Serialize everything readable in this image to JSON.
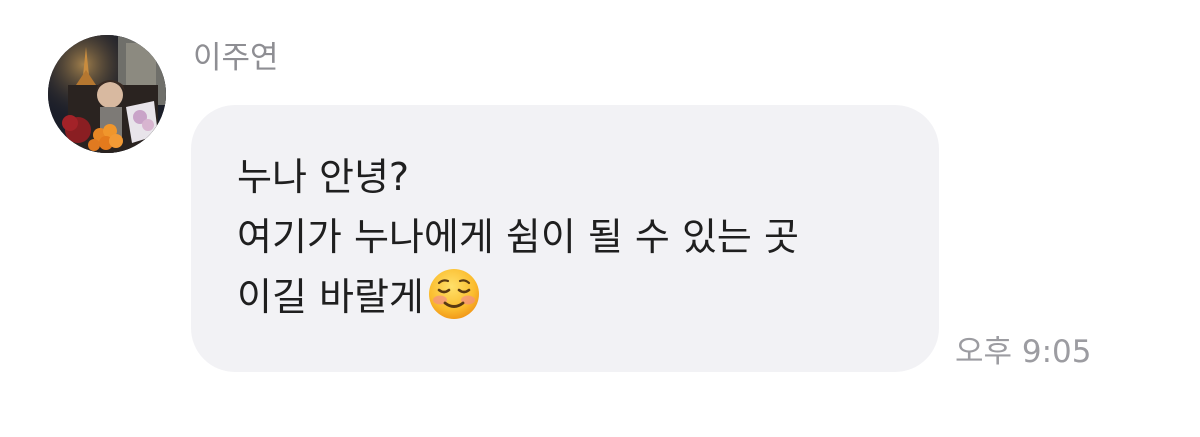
{
  "message": {
    "sender_name": "이주연",
    "avatar_icon": "profile-photo",
    "lines": [
      "누나 안녕?",
      "여기가 누나에게 쉼이 될 수 있는 곳",
      "이길 바랄게"
    ],
    "emoji": "smiling-face-icon",
    "timestamp": "오후 9:05"
  },
  "colors": {
    "bubble": "#f2f2f5",
    "text": "#1f1f1f",
    "meta_text": "#8e8e93"
  }
}
